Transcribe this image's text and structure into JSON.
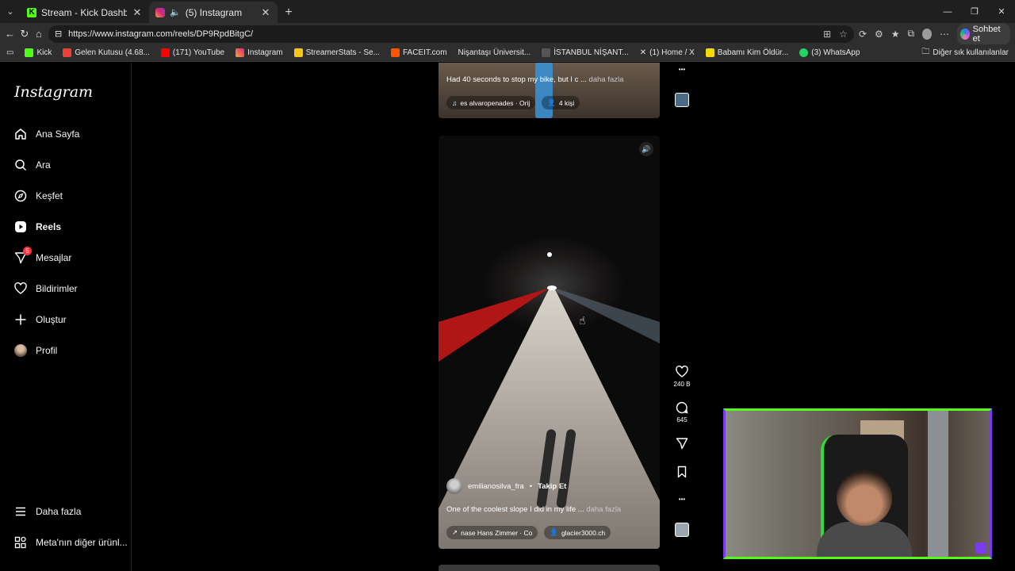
{
  "browser": {
    "tabs": [
      {
        "title": "Stream - Kick Dashboard",
        "active": false
      },
      {
        "title": "(5) Instagram",
        "active": true
      }
    ],
    "url": "https://www.instagram.com/reels/DP9RpdBitgC/",
    "copilot_label": "Sohbet et",
    "bookmarks": [
      "Kick",
      "Gelen Kutusu (4.68...",
      "(171) YouTube",
      "Instagram",
      "StreamerStats - Se...",
      "FACEIT.com",
      "Nişantaşı Üniversit...",
      "İSTANBUL NİŞANT...",
      "(1) Home / X",
      "Babamı Kim Öldür...",
      "(3) WhatsApp"
    ],
    "bookmarks_more": "Diğer sık kullanılanlar"
  },
  "sidebar": {
    "logo": "Instagram",
    "items": [
      {
        "label": "Ana Sayfa"
      },
      {
        "label": "Ara"
      },
      {
        "label": "Keşfet"
      },
      {
        "label": "Reels"
      },
      {
        "label": "Mesajlar",
        "badge": "5"
      },
      {
        "label": "Bildirimler"
      },
      {
        "label": "Oluştur"
      },
      {
        "label": "Profil"
      }
    ],
    "more": "Daha fazla",
    "meta": "Meta'nın diğer ürünl..."
  },
  "reel_prev": {
    "caption": "Had 40 seconds to stop my bike, but I c ...",
    "more": "daha fazla",
    "audio": "es  alvaropenades · Orij",
    "people": "4 kişi"
  },
  "reel_main": {
    "username": "emilianosilva_fra",
    "follow": "Takip Et",
    "caption": "One of the coolest slope I did in my life ...",
    "more": "daha fazla",
    "audio": "nase  Hans Zimmer · Co",
    "tagged": "glacier3000.ch",
    "likes": "240 B",
    "comments": "645"
  },
  "colors": {
    "kick_green": "#53fc18",
    "overlay_purple": "#7c3aed",
    "badge_red": "#ff3040"
  }
}
